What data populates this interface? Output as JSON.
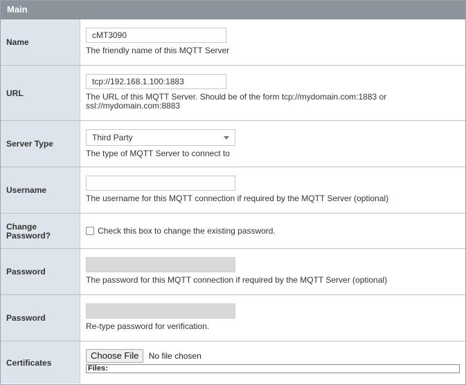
{
  "section": {
    "title": "Main"
  },
  "fields": {
    "name": {
      "label": "Name",
      "value": "cMT3090",
      "help": "The friendly name of this MQTT Server"
    },
    "url": {
      "label": "URL",
      "value": "tcp://192.168.1.100:1883",
      "help": "The URL of this MQTT Server. Should be of the form tcp://mydomain.com:1883 or ssl://mydomain.com:8883"
    },
    "server_type": {
      "label": "Server Type",
      "value": "Third Party",
      "help": "The type of MQTT Server to connect to"
    },
    "username": {
      "label": "Username",
      "value": "",
      "help": "The username for this MQTT connection if required by the MQTT Server (optional)"
    },
    "change_password": {
      "label": "Change Password?",
      "checkbox_label": "Check this box to change the existing password.",
      "checked": false
    },
    "password": {
      "label": "Password",
      "help": "The password for this MQTT connection if required by the MQTT Server (optional)"
    },
    "password_confirm": {
      "label": "Password",
      "help": "Re-type password for verification."
    },
    "certificates": {
      "label": "Certificates",
      "button_label": "Choose File",
      "status": "No file chosen",
      "files_label": "Files:"
    }
  },
  "colors": {
    "header_bg": "#8c939a",
    "label_bg": "#dde4ec",
    "disabled_input": "#d9d9d9"
  }
}
